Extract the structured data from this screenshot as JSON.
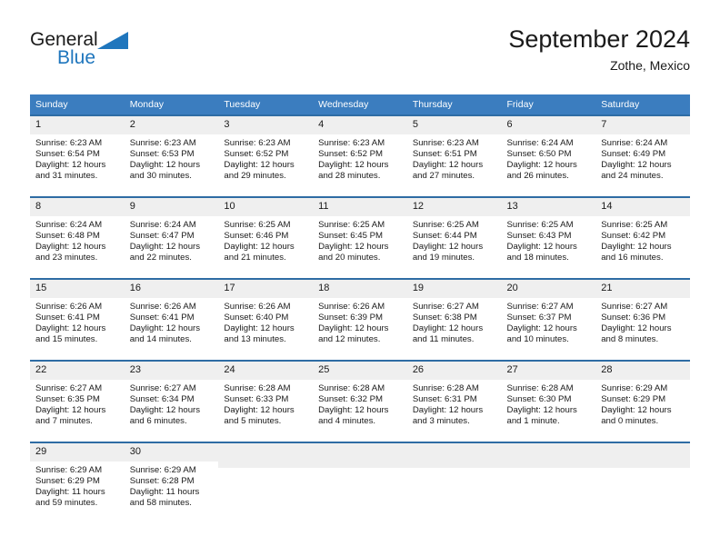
{
  "brand": {
    "line1": "General",
    "line2": "Blue",
    "triangle_color": "#1f76bd",
    "text_color": "#1a1a1a"
  },
  "header": {
    "title": "September 2024",
    "location": "Zothe, Mexico"
  },
  "theme": {
    "header_bg": "#3b7dbf",
    "header_text": "#ffffff",
    "daynum_bg": "#efefef",
    "cell_border": "#2e6ca4",
    "body_text": "#1a1a1a",
    "page_bg": "#ffffff"
  },
  "weekday_headers": [
    "Sunday",
    "Monday",
    "Tuesday",
    "Wednesday",
    "Thursday",
    "Friday",
    "Saturday"
  ],
  "labels": {
    "sunrise_prefix": "Sunrise:",
    "sunset_prefix": "Sunset:",
    "daylight_prefix": "Daylight:"
  },
  "weeks": [
    [
      {
        "day": "1",
        "sunrise": "Sunrise: 6:23 AM",
        "sunset": "Sunset: 6:54 PM",
        "daylight_a": "Daylight: 12 hours",
        "daylight_b": "and 31 minutes."
      },
      {
        "day": "2",
        "sunrise": "Sunrise: 6:23 AM",
        "sunset": "Sunset: 6:53 PM",
        "daylight_a": "Daylight: 12 hours",
        "daylight_b": "and 30 minutes."
      },
      {
        "day": "3",
        "sunrise": "Sunrise: 6:23 AM",
        "sunset": "Sunset: 6:52 PM",
        "daylight_a": "Daylight: 12 hours",
        "daylight_b": "and 29 minutes."
      },
      {
        "day": "4",
        "sunrise": "Sunrise: 6:23 AM",
        "sunset": "Sunset: 6:52 PM",
        "daylight_a": "Daylight: 12 hours",
        "daylight_b": "and 28 minutes."
      },
      {
        "day": "5",
        "sunrise": "Sunrise: 6:23 AM",
        "sunset": "Sunset: 6:51 PM",
        "daylight_a": "Daylight: 12 hours",
        "daylight_b": "and 27 minutes."
      },
      {
        "day": "6",
        "sunrise": "Sunrise: 6:24 AM",
        "sunset": "Sunset: 6:50 PM",
        "daylight_a": "Daylight: 12 hours",
        "daylight_b": "and 26 minutes."
      },
      {
        "day": "7",
        "sunrise": "Sunrise: 6:24 AM",
        "sunset": "Sunset: 6:49 PM",
        "daylight_a": "Daylight: 12 hours",
        "daylight_b": "and 24 minutes."
      }
    ],
    [
      {
        "day": "8",
        "sunrise": "Sunrise: 6:24 AM",
        "sunset": "Sunset: 6:48 PM",
        "daylight_a": "Daylight: 12 hours",
        "daylight_b": "and 23 minutes."
      },
      {
        "day": "9",
        "sunrise": "Sunrise: 6:24 AM",
        "sunset": "Sunset: 6:47 PM",
        "daylight_a": "Daylight: 12 hours",
        "daylight_b": "and 22 minutes."
      },
      {
        "day": "10",
        "sunrise": "Sunrise: 6:25 AM",
        "sunset": "Sunset: 6:46 PM",
        "daylight_a": "Daylight: 12 hours",
        "daylight_b": "and 21 minutes."
      },
      {
        "day": "11",
        "sunrise": "Sunrise: 6:25 AM",
        "sunset": "Sunset: 6:45 PM",
        "daylight_a": "Daylight: 12 hours",
        "daylight_b": "and 20 minutes."
      },
      {
        "day": "12",
        "sunrise": "Sunrise: 6:25 AM",
        "sunset": "Sunset: 6:44 PM",
        "daylight_a": "Daylight: 12 hours",
        "daylight_b": "and 19 minutes."
      },
      {
        "day": "13",
        "sunrise": "Sunrise: 6:25 AM",
        "sunset": "Sunset: 6:43 PM",
        "daylight_a": "Daylight: 12 hours",
        "daylight_b": "and 18 minutes."
      },
      {
        "day": "14",
        "sunrise": "Sunrise: 6:25 AM",
        "sunset": "Sunset: 6:42 PM",
        "daylight_a": "Daylight: 12 hours",
        "daylight_b": "and 16 minutes."
      }
    ],
    [
      {
        "day": "15",
        "sunrise": "Sunrise: 6:26 AM",
        "sunset": "Sunset: 6:41 PM",
        "daylight_a": "Daylight: 12 hours",
        "daylight_b": "and 15 minutes."
      },
      {
        "day": "16",
        "sunrise": "Sunrise: 6:26 AM",
        "sunset": "Sunset: 6:41 PM",
        "daylight_a": "Daylight: 12 hours",
        "daylight_b": "and 14 minutes."
      },
      {
        "day": "17",
        "sunrise": "Sunrise: 6:26 AM",
        "sunset": "Sunset: 6:40 PM",
        "daylight_a": "Daylight: 12 hours",
        "daylight_b": "and 13 minutes."
      },
      {
        "day": "18",
        "sunrise": "Sunrise: 6:26 AM",
        "sunset": "Sunset: 6:39 PM",
        "daylight_a": "Daylight: 12 hours",
        "daylight_b": "and 12 minutes."
      },
      {
        "day": "19",
        "sunrise": "Sunrise: 6:27 AM",
        "sunset": "Sunset: 6:38 PM",
        "daylight_a": "Daylight: 12 hours",
        "daylight_b": "and 11 minutes."
      },
      {
        "day": "20",
        "sunrise": "Sunrise: 6:27 AM",
        "sunset": "Sunset: 6:37 PM",
        "daylight_a": "Daylight: 12 hours",
        "daylight_b": "and 10 minutes."
      },
      {
        "day": "21",
        "sunrise": "Sunrise: 6:27 AM",
        "sunset": "Sunset: 6:36 PM",
        "daylight_a": "Daylight: 12 hours",
        "daylight_b": "and 8 minutes."
      }
    ],
    [
      {
        "day": "22",
        "sunrise": "Sunrise: 6:27 AM",
        "sunset": "Sunset: 6:35 PM",
        "daylight_a": "Daylight: 12 hours",
        "daylight_b": "and 7 minutes."
      },
      {
        "day": "23",
        "sunrise": "Sunrise: 6:27 AM",
        "sunset": "Sunset: 6:34 PM",
        "daylight_a": "Daylight: 12 hours",
        "daylight_b": "and 6 minutes."
      },
      {
        "day": "24",
        "sunrise": "Sunrise: 6:28 AM",
        "sunset": "Sunset: 6:33 PM",
        "daylight_a": "Daylight: 12 hours",
        "daylight_b": "and 5 minutes."
      },
      {
        "day": "25",
        "sunrise": "Sunrise: 6:28 AM",
        "sunset": "Sunset: 6:32 PM",
        "daylight_a": "Daylight: 12 hours",
        "daylight_b": "and 4 minutes."
      },
      {
        "day": "26",
        "sunrise": "Sunrise: 6:28 AM",
        "sunset": "Sunset: 6:31 PM",
        "daylight_a": "Daylight: 12 hours",
        "daylight_b": "and 3 minutes."
      },
      {
        "day": "27",
        "sunrise": "Sunrise: 6:28 AM",
        "sunset": "Sunset: 6:30 PM",
        "daylight_a": "Daylight: 12 hours",
        "daylight_b": "and 1 minute."
      },
      {
        "day": "28",
        "sunrise": "Sunrise: 6:29 AM",
        "sunset": "Sunset: 6:29 PM",
        "daylight_a": "Daylight: 12 hours",
        "daylight_b": "and 0 minutes."
      }
    ],
    [
      {
        "day": "29",
        "sunrise": "Sunrise: 6:29 AM",
        "sunset": "Sunset: 6:29 PM",
        "daylight_a": "Daylight: 11 hours",
        "daylight_b": "and 59 minutes."
      },
      {
        "day": "30",
        "sunrise": "Sunrise: 6:29 AM",
        "sunset": "Sunset: 6:28 PM",
        "daylight_a": "Daylight: 11 hours",
        "daylight_b": "and 58 minutes."
      },
      {
        "day": "",
        "sunrise": "",
        "sunset": "",
        "daylight_a": "",
        "daylight_b": ""
      },
      {
        "day": "",
        "sunrise": "",
        "sunset": "",
        "daylight_a": "",
        "daylight_b": ""
      },
      {
        "day": "",
        "sunrise": "",
        "sunset": "",
        "daylight_a": "",
        "daylight_b": ""
      },
      {
        "day": "",
        "sunrise": "",
        "sunset": "",
        "daylight_a": "",
        "daylight_b": ""
      },
      {
        "day": "",
        "sunrise": "",
        "sunset": "",
        "daylight_a": "",
        "daylight_b": ""
      }
    ]
  ]
}
